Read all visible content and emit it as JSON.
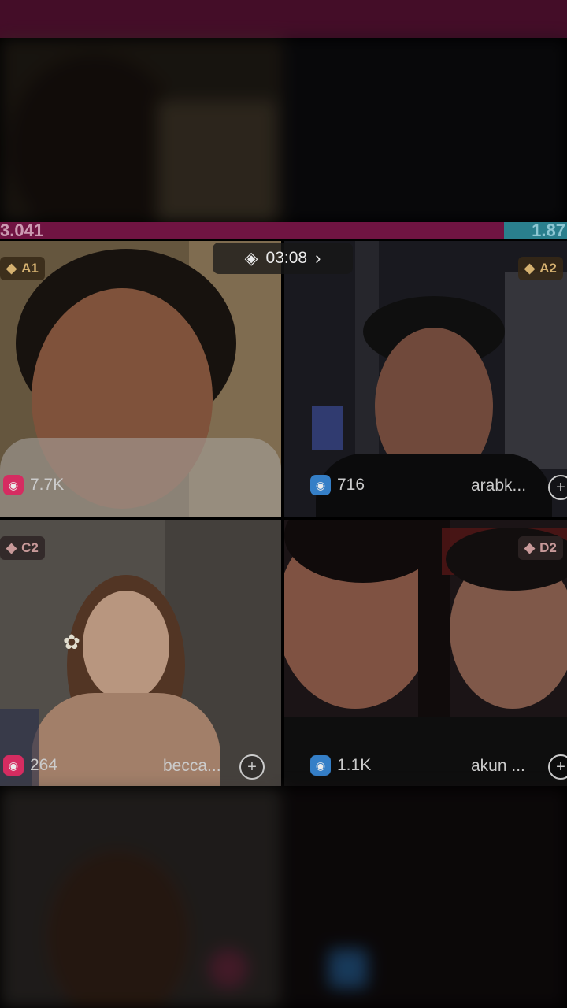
{
  "battle": {
    "score_left": "3.041",
    "score_right": "1.87",
    "timer": "03:08",
    "timer_icon": "diamond-shield-icon",
    "timer_chevron": "chevron-right-icon"
  },
  "tiles": [
    {
      "id": "A1",
      "badge": "A1",
      "viewers": "7.7K",
      "name": ""
    },
    {
      "id": "A2",
      "badge": "A2",
      "viewers": "716",
      "name": "arabk..."
    },
    {
      "id": "C2",
      "badge": "C2",
      "viewers": "264",
      "name": "becca..."
    },
    {
      "id": "D2",
      "badge": "D2",
      "viewers": "1.1K",
      "name": "akun ..."
    }
  ],
  "colors": {
    "topbar": "#4a0f2c",
    "score_bar": "#7a1648",
    "score_bar_right": "#2e8a9a",
    "badge_gold": "#e8c07a",
    "viewer_pink": "#e8306a",
    "viewer_blue": "#3a8ad8"
  }
}
